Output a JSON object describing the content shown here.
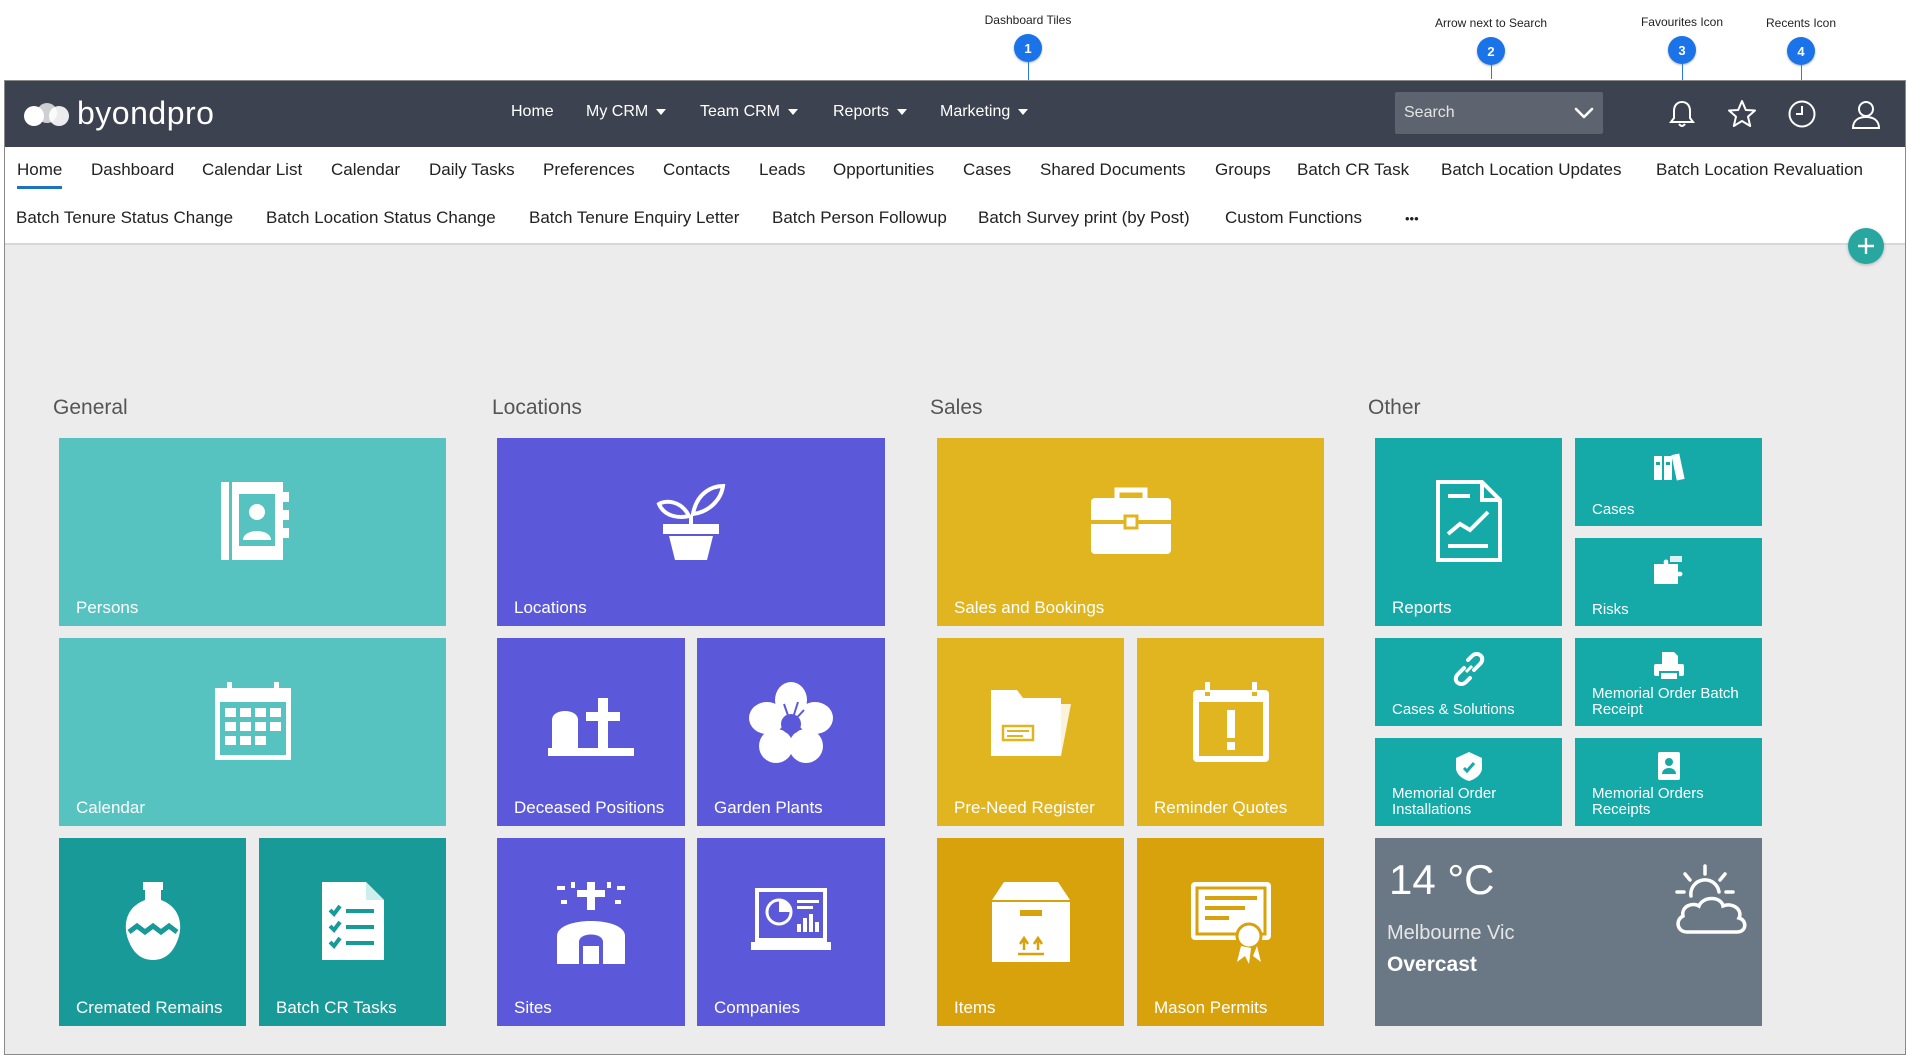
{
  "callouts": [
    {
      "num": "1",
      "label": "Dashboard Tiles"
    },
    {
      "num": "2",
      "label": "Arrow next to Search"
    },
    {
      "num": "3",
      "label": "Favourites Icon"
    },
    {
      "num": "4",
      "label": "Recents Icon"
    }
  ],
  "brand": {
    "name": "byondpro"
  },
  "topnav": {
    "home": "Home",
    "my_crm": "My CRM",
    "team_crm": "Team CRM",
    "reports": "Reports",
    "marketing": "Marketing"
  },
  "search": {
    "placeholder": "Search"
  },
  "tabs_row1": [
    "Home",
    "Dashboard",
    "Calendar List",
    "Calendar",
    "Daily Tasks",
    "Preferences",
    "Contacts",
    "Leads",
    "Opportunities",
    "Cases",
    "Shared Documents",
    "Groups",
    "Batch CR Task",
    "Batch Location Updates",
    "Batch Location Revaluation"
  ],
  "tabs_row2": [
    "Batch Tenure Status Change",
    "Batch Location Status Change",
    "Batch Tenure Enquiry Letter",
    "Batch Person Followup",
    "Batch Survey print (by Post)",
    "Custom Functions",
    "•••"
  ],
  "active_tab": "Home",
  "sections": {
    "general": "General",
    "locations": "Locations",
    "sales": "Sales",
    "other": "Other"
  },
  "tiles": {
    "persons": "Persons",
    "calendar": "Calendar",
    "cremated_remains": "Cremated Remains",
    "batch_cr_tasks": "Batch CR Tasks",
    "locations": "Locations",
    "deceased_positions": "Deceased Positions",
    "garden_plants": "Garden Plants",
    "sites": "Sites",
    "companies": "Companies",
    "sales_and_bookings": "Sales and Bookings",
    "pre_need_register": "Pre-Need Register",
    "reminder_quotes": "Reminder Quotes",
    "items": "Items",
    "mason_permits": "Mason Permits",
    "reports": "Reports",
    "cases": "Cases",
    "risks": "Risks",
    "cases_solutions": "Cases & Solutions",
    "memorial_order_batch_receipt_1": "Memorial Order Batch",
    "memorial_order_batch_receipt_2": "Receipt",
    "memorial_order_installations_1": "Memorial Order",
    "memorial_order_installations_2": "Installations",
    "memorial_orders_receipts_1": "Memorial Orders",
    "memorial_orders_receipts_2": "Receipts"
  },
  "weather": {
    "temp": "14 °C",
    "city": "Melbourne Vic",
    "condition": "Overcast"
  },
  "colors": {
    "topbar": "#3d4250",
    "general_light": "#56c3c0",
    "general_dark": "#179a98",
    "locations": "#5b59d9",
    "sales": "#e0b520",
    "sales_dark": "#d8a20c",
    "other": "#15aaa8",
    "weather": "#6a7784",
    "accent": "#1a73e8"
  }
}
